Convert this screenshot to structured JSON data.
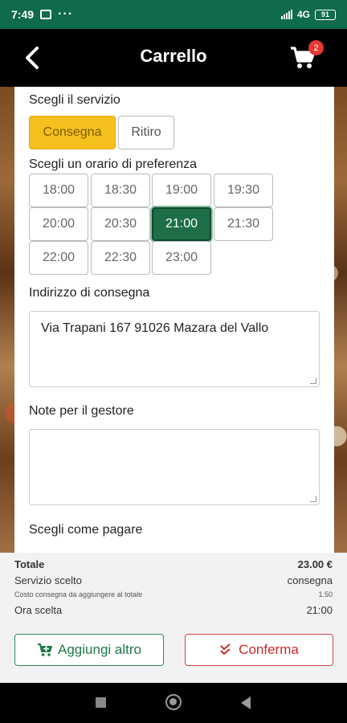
{
  "status": {
    "time": "7:49",
    "network": "4G",
    "battery": "91"
  },
  "header": {
    "title": "Carrello",
    "cart_count": "2"
  },
  "service": {
    "label": "Scegli il servizio",
    "options": [
      "Consegna",
      "Ritiro"
    ],
    "selected": "Consegna"
  },
  "time_slots": {
    "label": "Scegli un orario di preferenza",
    "slots": [
      "18:00",
      "18:30",
      "19:00",
      "19:30",
      "20:00",
      "20:30",
      "21:00",
      "21:30",
      "22:00",
      "22:30",
      "23:00"
    ],
    "selected": "21:00"
  },
  "address": {
    "label": "Indirizzo di consegna",
    "value": "Via Trapani 167 91026 Mazara del Vallo"
  },
  "notes": {
    "label": "Note per il gestore",
    "value": ""
  },
  "payment": {
    "label": "Scegli come pagare"
  },
  "summary": {
    "total_label": "Totale",
    "total_value": "23.00 €",
    "service_label": "Servizio scelto",
    "service_value": "consegna",
    "delivery_cost_label": "Costo consegna da aggiungere al totale",
    "delivery_cost_value": "1.50",
    "time_label": "Ora scelta",
    "time_value": "21:00"
  },
  "actions": {
    "add_more": "Aggiungi altro",
    "confirm": "Conferma"
  },
  "colors": {
    "status_bar": "#0f6b4a",
    "accent_yellow": "#f5c01d",
    "selected_green": "#1e6e48",
    "confirm_red": "#cc2a2a"
  }
}
